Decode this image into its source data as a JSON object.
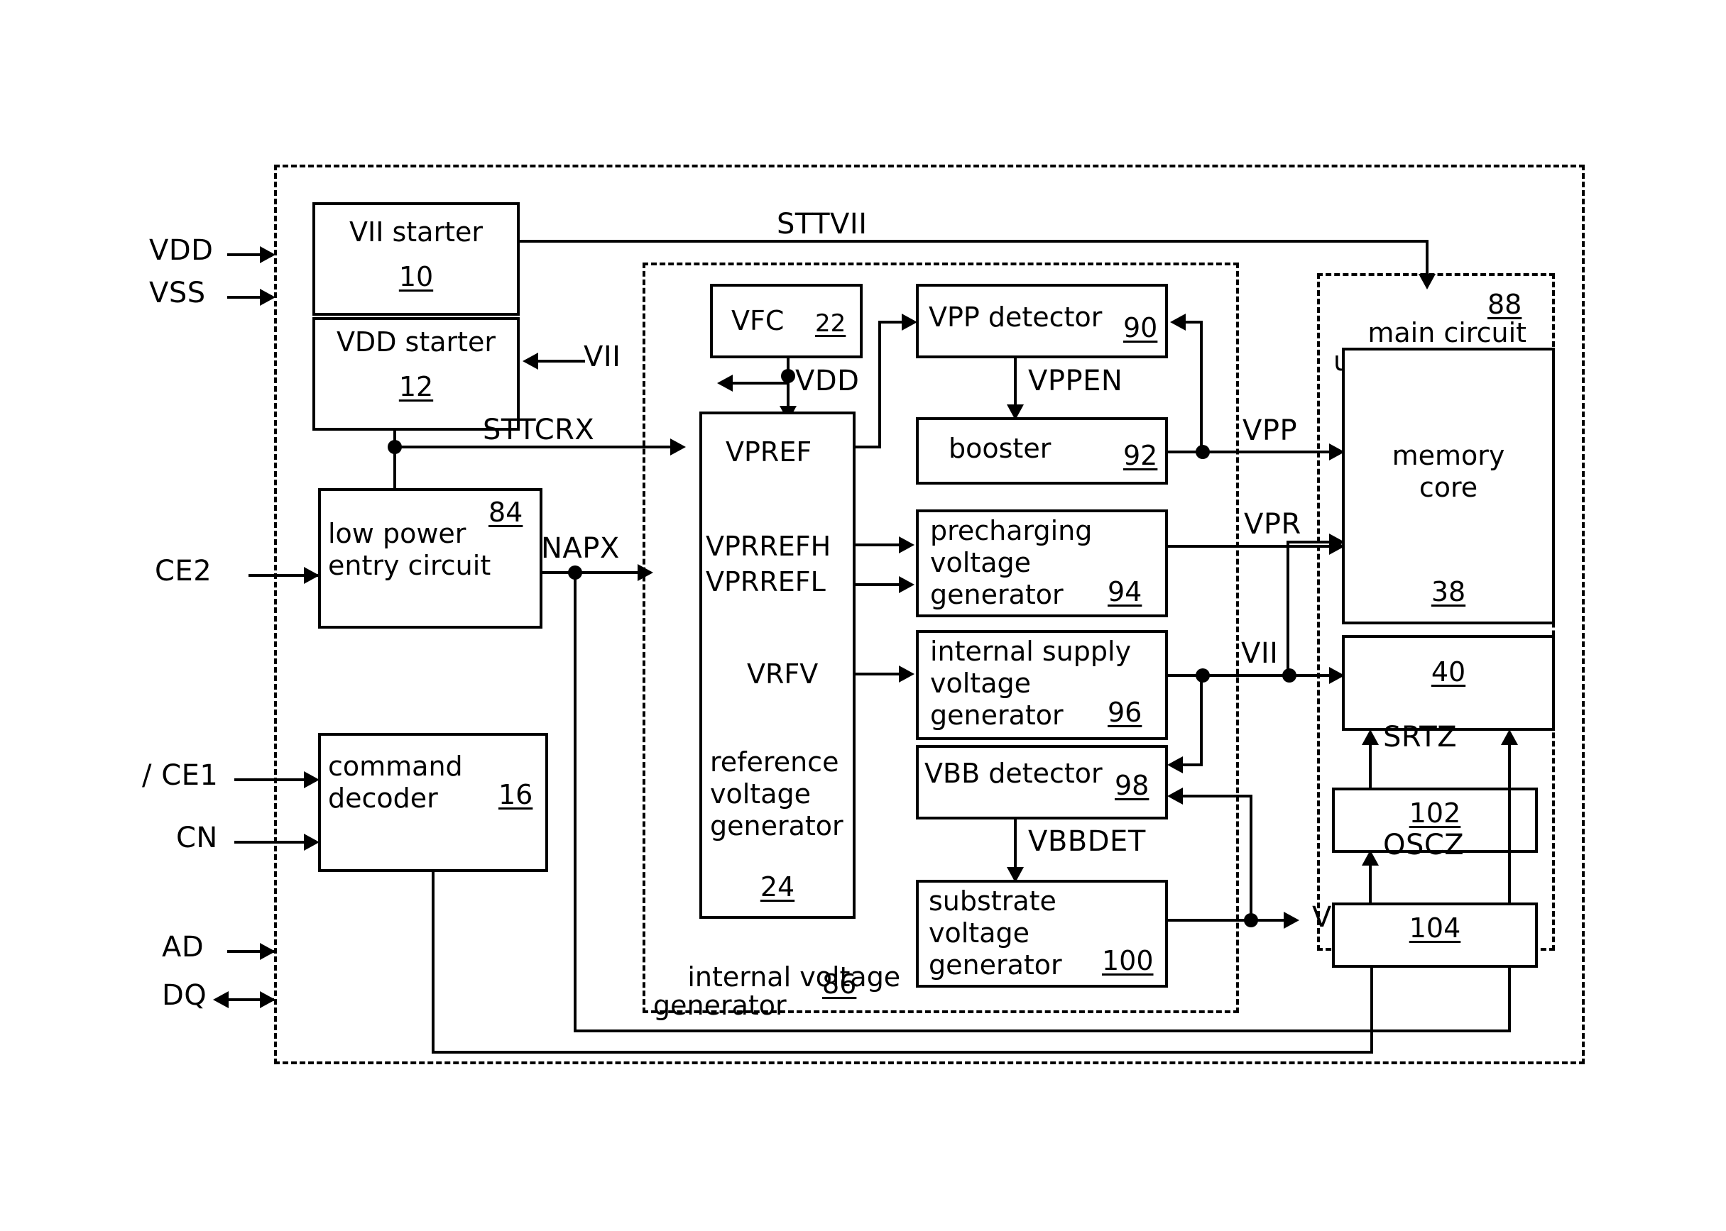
{
  "figure": {
    "type": "semiconductor-block-diagram",
    "description": "Memory device internal voltage generation block diagram"
  },
  "external_signals": {
    "vdd": "VDD",
    "vss": "VSS",
    "ce2": "CE2",
    "ce1": "/ CE1",
    "cn": "CN",
    "ad": "AD",
    "dq": "DQ"
  },
  "blocks": {
    "vii_starter": {
      "label": "VII starter",
      "num": "10"
    },
    "vdd_starter": {
      "label": "VDD starter",
      "num": "12"
    },
    "low_power": {
      "label": "low power\nentry circuit",
      "num": "84"
    },
    "command_decoder": {
      "label": "command\ndecoder",
      "num": "16"
    },
    "vfc": {
      "label": "VFC",
      "num": "22"
    },
    "ref_voltage_gen": {
      "label": "reference\nvoltage\ngenerator",
      "num": "24"
    },
    "vpp_detector": {
      "label": "VPP detector",
      "num": "90"
    },
    "booster": {
      "label": "booster",
      "num": "92"
    },
    "precharging_gen": {
      "label": "precharging\nvoltage\ngenerator",
      "num": "94"
    },
    "internal_supply_gen": {
      "label": "internal supply\nvoltage\ngenerator",
      "num": "96"
    },
    "vbb_detector": {
      "label": "VBB detector",
      "num": "98"
    },
    "substrate_gen": {
      "label": "substrate\nvoltage\ngenerator",
      "num": "100"
    },
    "memory_core": {
      "label": "memory\ncore",
      "num": "38"
    },
    "block_40": {
      "label": "",
      "num": "40"
    },
    "block_102": {
      "label": "",
      "num": "102"
    },
    "block_104": {
      "label": "",
      "num": "104"
    }
  },
  "groups": {
    "internal_voltage_generator": {
      "label": "internal voltage\ngenerator",
      "num": "86"
    },
    "main_circuit_unit": {
      "label": "main circuit\nunit",
      "num": "88"
    }
  },
  "internal_signals": {
    "sttvii": "STTVII",
    "sttcrx": "STTCRX",
    "vii_in": "VII",
    "napx": "NAPX",
    "vdd_node": "VDD",
    "vpref": "VPREF",
    "vprrefh": "VPRREFH",
    "vprrefl": "VPRREFL",
    "vrfv": "VRFV",
    "vppen": "VPPEN",
    "vbbdet": "VBBDET",
    "vpp": "VPP",
    "vpr": "VPR",
    "vii_out": "VII",
    "vbb": "VBB",
    "srtz": "SRTZ",
    "oscz": "OSCZ"
  },
  "colors": {
    "ink": "#000000",
    "paper": "#ffffff"
  }
}
